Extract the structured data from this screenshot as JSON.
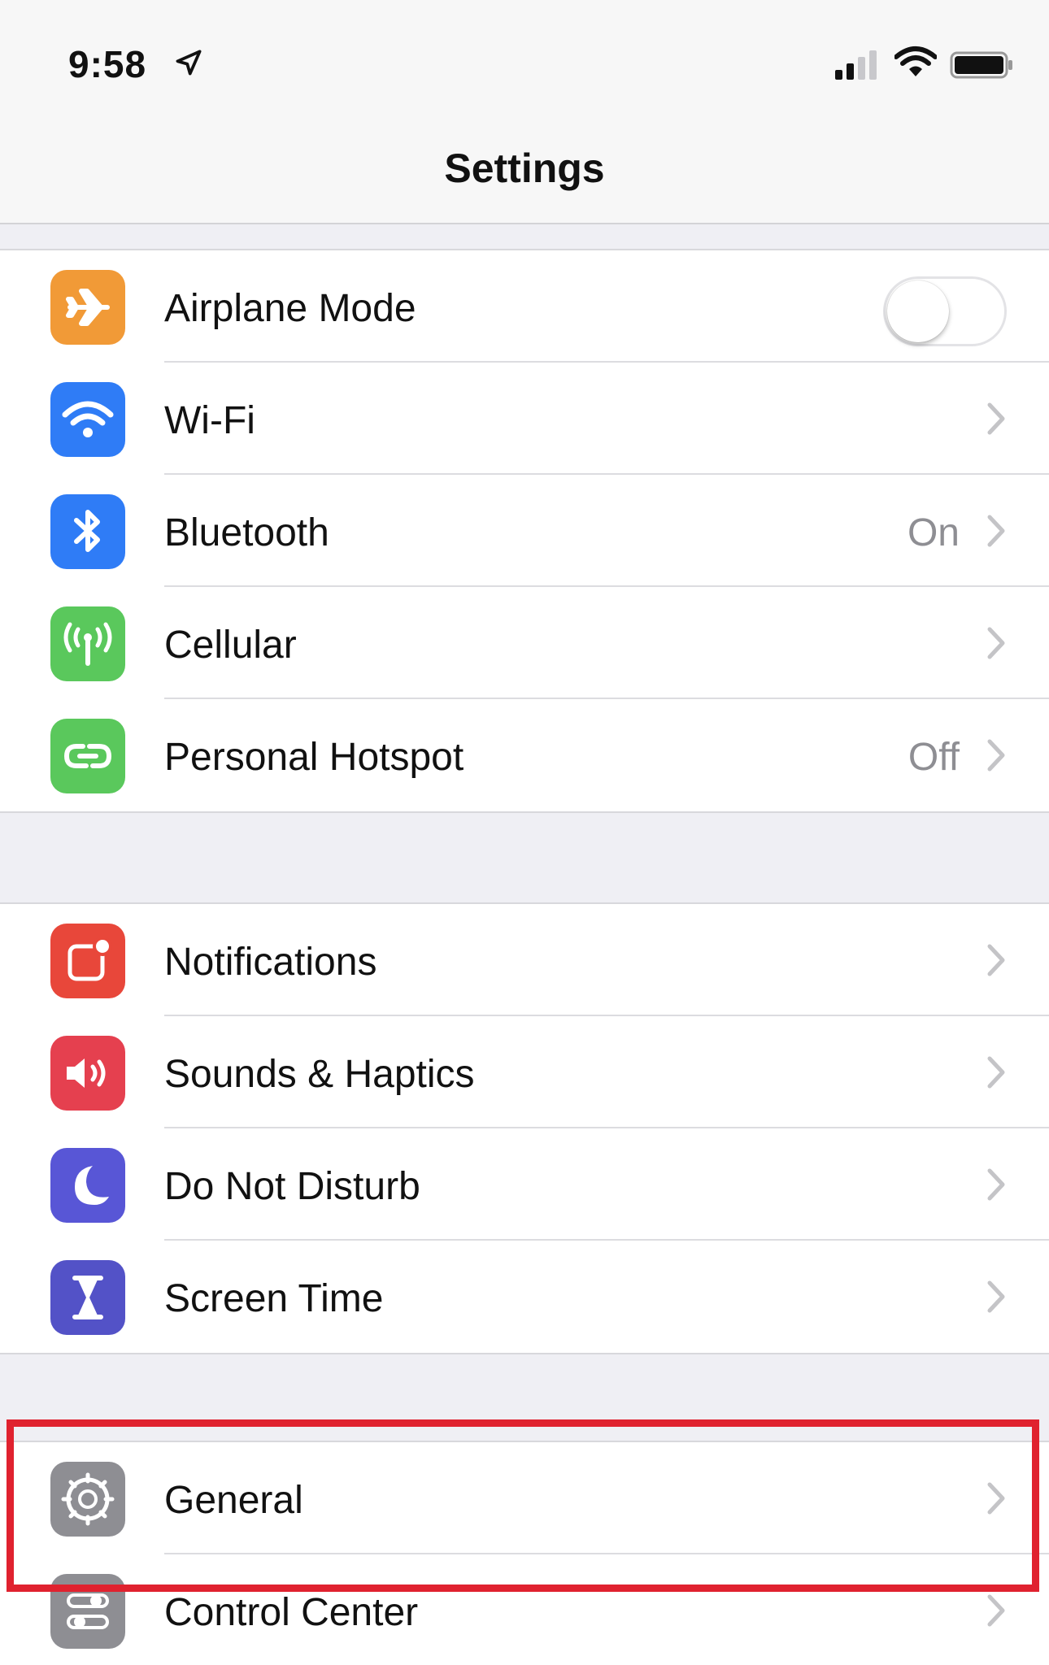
{
  "status_bar": {
    "time": "9:58",
    "location_icon": "location-arrow-icon",
    "signal_icon": "cellular-signal-icon",
    "wifi_icon": "wifi-status-icon",
    "battery_icon": "battery-icon"
  },
  "nav": {
    "title": "Settings"
  },
  "colors": {
    "airplane": "#f19a37",
    "wifi": "#2f7cf6",
    "bluetooth": "#2f7cf6",
    "cellular": "#5ac85c",
    "hotspot": "#5ac85c",
    "notifications": "#e8473a",
    "sounds": "#e5404f",
    "do_not_disturb": "#5856d6",
    "screen_time": "#5352c7",
    "general": "#8e8e93",
    "control_center": "#8e8e93",
    "highlight": "#e0222f"
  },
  "sections": [
    {
      "rows": [
        {
          "label": "Airplane Mode",
          "icon": "airplane-icon",
          "control": "toggle",
          "toggle_on": false
        },
        {
          "label": "Wi-Fi",
          "icon": "wifi-icon",
          "value": ""
        },
        {
          "label": "Bluetooth",
          "icon": "bluetooth-icon",
          "value": "On"
        },
        {
          "label": "Cellular",
          "icon": "antenna-icon",
          "value": ""
        },
        {
          "label": "Personal Hotspot",
          "icon": "hotspot-icon",
          "value": "Off"
        }
      ]
    },
    {
      "rows": [
        {
          "label": "Notifications",
          "icon": "notifications-icon"
        },
        {
          "label": "Sounds & Haptics",
          "icon": "speaker-icon"
        },
        {
          "label": "Do Not Disturb",
          "icon": "moon-icon"
        },
        {
          "label": "Screen Time",
          "icon": "hourglass-icon"
        }
      ]
    },
    {
      "rows": [
        {
          "label": "General",
          "icon": "gear-icon",
          "highlighted": true
        },
        {
          "label": "Control Center",
          "icon": "control-center-icon"
        }
      ]
    }
  ]
}
